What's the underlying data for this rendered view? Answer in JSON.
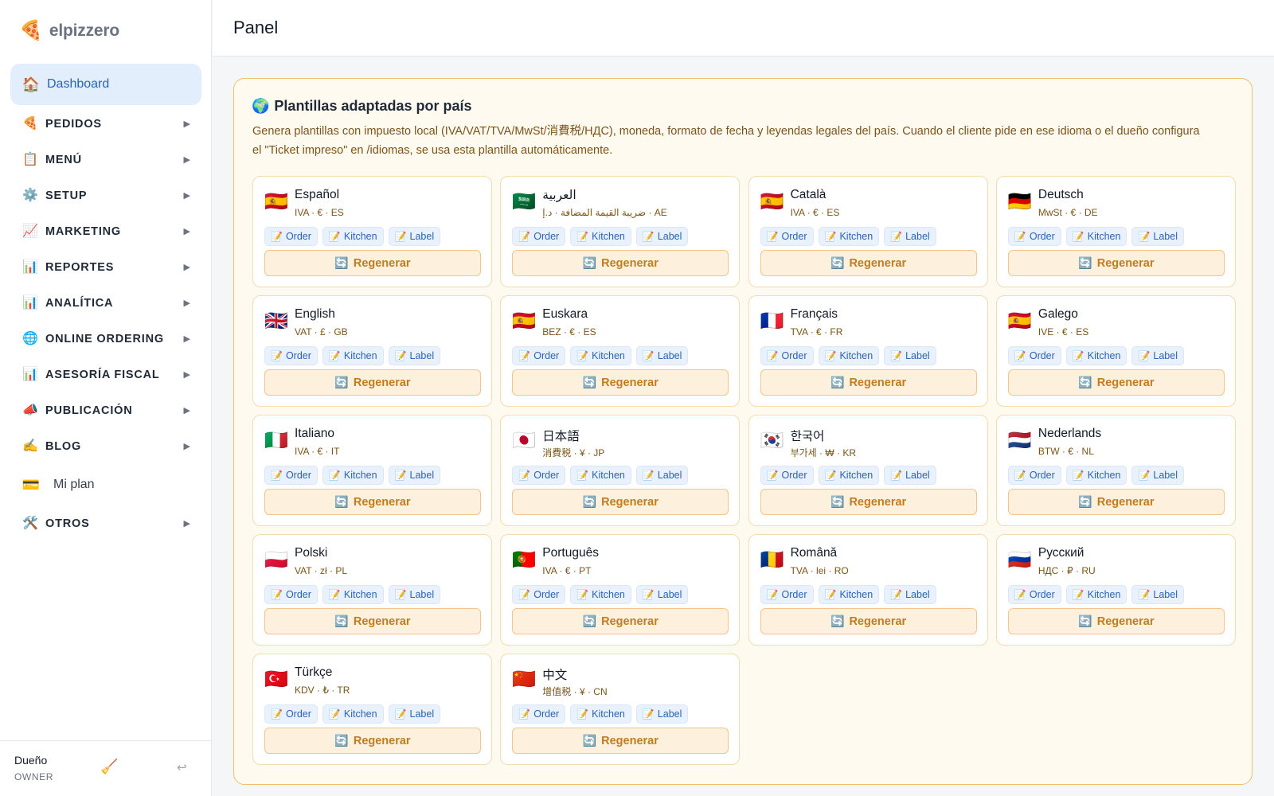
{
  "brand": {
    "name": "elpizzero",
    "icon": "🍕"
  },
  "sidebar": {
    "items": [
      {
        "label": "Dashboard",
        "icon": "🏠",
        "icon_name": "house-icon",
        "active": true,
        "arrow": false
      },
      {
        "label": "PEDIDOS",
        "icon": "🍕",
        "icon_name": "pizza-icon",
        "arrow": true
      },
      {
        "label": "MENÚ",
        "icon": "📋",
        "icon_name": "clipboard-icon",
        "arrow": true
      },
      {
        "label": "SETUP",
        "icon": "⚙️",
        "icon_name": "gear-icon",
        "arrow": true
      },
      {
        "label": "MARKETING",
        "icon": "📈",
        "icon_name": "trend-chart-icon",
        "arrow": true
      },
      {
        "label": "REPORTES",
        "icon": "📊",
        "icon_name": "bar-chart-icon",
        "arrow": true
      },
      {
        "label": "ANALÍTICA",
        "icon": "📊",
        "icon_name": "bar-chart-icon",
        "arrow": true
      },
      {
        "label": "ONLINE ORDERING",
        "icon": "🌐",
        "icon_name": "globe-icon",
        "arrow": true
      },
      {
        "label": "ASESORÍA FISCAL",
        "icon": "📊",
        "icon_name": "bar-chart-icon",
        "arrow": true
      },
      {
        "label": "PUBLICACIÓN",
        "icon": "📣",
        "icon_name": "megaphone-icon",
        "arrow": true
      },
      {
        "label": "BLOG",
        "icon": "✍️",
        "icon_name": "writing-hand-icon",
        "arrow": true
      },
      {
        "label": "Mi plan",
        "icon": "💳",
        "icon_name": "credit-card-icon",
        "plain": true,
        "arrow": false
      },
      {
        "label": "OTROS",
        "icon": "🛠️",
        "icon_name": "tools-icon",
        "arrow": true
      }
    ],
    "arrow_glyph": "▶"
  },
  "user": {
    "name": "Dueño",
    "role": "OWNER",
    "broom_icon": "🧹",
    "logout_icon": "↩"
  },
  "header": {
    "title": "Panel"
  },
  "panel": {
    "icon": "🌍",
    "title": "Plantillas adaptadas por país",
    "description": "Genera plantillas con impuesto local (IVA/VAT/TVA/MwSt/消費税/НДС), moneda, formato de fecha y leyendas legales del país. Cuando el cliente pide en ese idioma o el dueño configura el \"Ticket impreso\" en /idiomas, se usa esta plantilla automáticamente.",
    "chip_labels": [
      "Order",
      "Kitchen",
      "Label"
    ],
    "chip_icon": "📝",
    "regen_label": "Regenerar",
    "regen_icon": "🔄",
    "templates": [
      {
        "flag": "🇪🇸",
        "name": "Español",
        "meta": "IVA · € · ES"
      },
      {
        "flag": "🇸🇦",
        "name": "العربية",
        "meta": "ضريبة القيمة المضافة · د.إ · AE"
      },
      {
        "flag": "🇪🇸",
        "name": "Català",
        "meta": "IVA · € · ES"
      },
      {
        "flag": "🇩🇪",
        "name": "Deutsch",
        "meta": "MwSt · € · DE"
      },
      {
        "flag": "🇬🇧",
        "name": "English",
        "meta": "VAT · £ · GB"
      },
      {
        "flag": "🇪🇸",
        "name": "Euskara",
        "meta": "BEZ · € · ES"
      },
      {
        "flag": "🇫🇷",
        "name": "Français",
        "meta": "TVA · € · FR"
      },
      {
        "flag": "🇪🇸",
        "name": "Galego",
        "meta": "IVE · € · ES"
      },
      {
        "flag": "🇮🇹",
        "name": "Italiano",
        "meta": "IVA · € · IT"
      },
      {
        "flag": "🇯🇵",
        "name": "日本語",
        "meta": "消費税 · ¥ · JP"
      },
      {
        "flag": "🇰🇷",
        "name": "한국어",
        "meta": "부가세 · ₩ · KR"
      },
      {
        "flag": "🇳🇱",
        "name": "Nederlands",
        "meta": "BTW · € · NL"
      },
      {
        "flag": "🇵🇱",
        "name": "Polski",
        "meta": "VAT · zł · PL"
      },
      {
        "flag": "🇵🇹",
        "name": "Português",
        "meta": "IVA · € · PT"
      },
      {
        "flag": "🇷🇴",
        "name": "Română",
        "meta": "TVA · lei · RO"
      },
      {
        "flag": "🇷🇺",
        "name": "Русский",
        "meta": "НДС · ₽ · RU"
      },
      {
        "flag": "🇹🇷",
        "name": "Türkçe",
        "meta": "KDV · ₺ · TR"
      },
      {
        "flag": "🇨🇳",
        "name": "中文",
        "meta": "增值税 · ¥ · CN"
      }
    ]
  }
}
